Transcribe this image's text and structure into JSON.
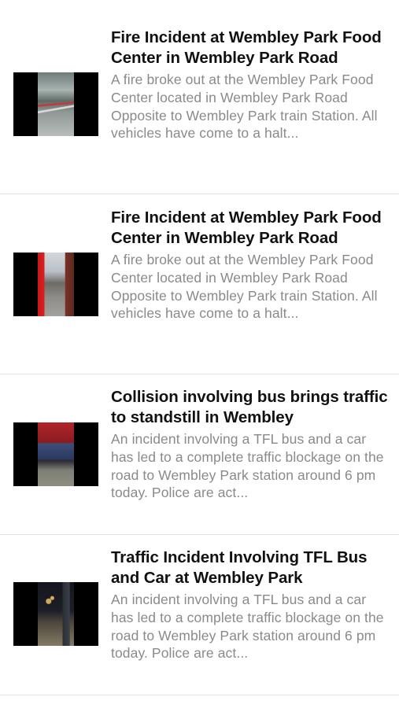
{
  "feed": {
    "items": [
      {
        "title": "Fire Incident at Wembley Park Food Center in Wembley Park Road",
        "summary": "A fire broke out at the Wembley Park Food Center located in Wembley Park Road Opposite to Wembley Park train Station. All vehicles have come to a halt...",
        "thumbnail": "fire-incident-photo"
      },
      {
        "title": "Fire Incident at Wembley Park Food Center in Wembley Park Road",
        "summary": "A fire broke out at the Wembley Park Food Center located in Wembley Park Road Opposite to Wembley Park train Station. All vehicles have come to a halt...",
        "thumbnail": "fire-engine-photo"
      },
      {
        "title": "Collision involving bus brings traffic to standstill in Wembley",
        "summary": "An incident involving a TFL bus and a car has led to a complete traffic blockage on the road to Wembley Park station around 6 pm today. Police are act...",
        "thumbnail": "bus-collision-photo"
      },
      {
        "title": "Traffic Incident Involving TFL Bus and Car at Wembley Park",
        "summary": "An incident involving a TFL bus and a car has led to a complete traffic blockage on the road to Wembley Park station around 6 pm today. Police are act...",
        "thumbnail": "night-traffic-photo"
      }
    ]
  }
}
